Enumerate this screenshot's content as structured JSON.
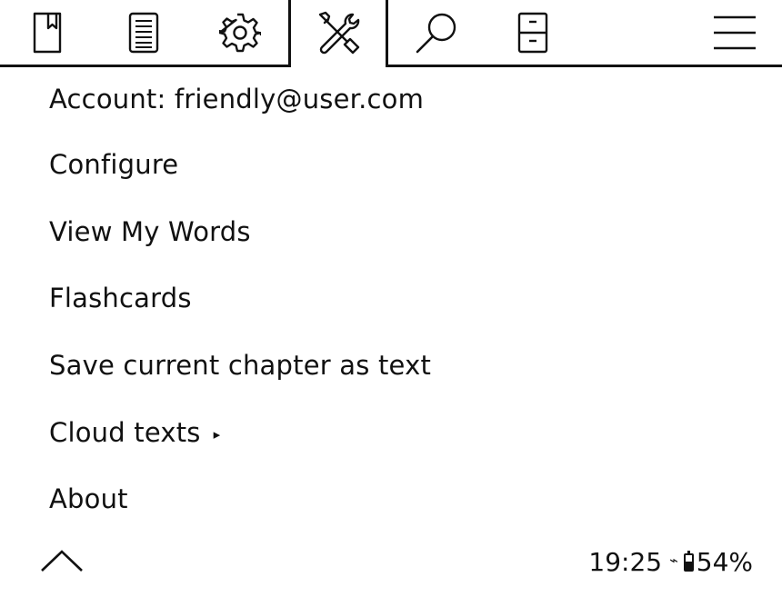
{
  "tabbar": {
    "tabs": [
      {
        "icon": "bookmark-icon"
      },
      {
        "icon": "document-icon"
      },
      {
        "icon": "gear-icon"
      },
      {
        "icon": "tools-icon",
        "active": true
      },
      {
        "icon": "search-icon"
      },
      {
        "icon": "cabinet-icon"
      },
      {
        "icon": "hamburger-menu-icon"
      }
    ]
  },
  "menu": {
    "items": [
      {
        "label": "Account: friendly@user.com"
      },
      {
        "label": "Configure"
      },
      {
        "label": "View My Words"
      },
      {
        "label": "Flashcards"
      },
      {
        "label": "Save current chapter as text"
      },
      {
        "label": "Cloud texts",
        "submenu_arrow": "▸"
      },
      {
        "label": "About"
      }
    ]
  },
  "footer": {
    "collapse_icon": "chevron-up-icon",
    "time": "19:25",
    "wifi_glyph": "⌁",
    "battery_level": 0.54,
    "battery_text": "54%"
  },
  "colors": {
    "ink": "#111111",
    "background": "#ffffff"
  }
}
